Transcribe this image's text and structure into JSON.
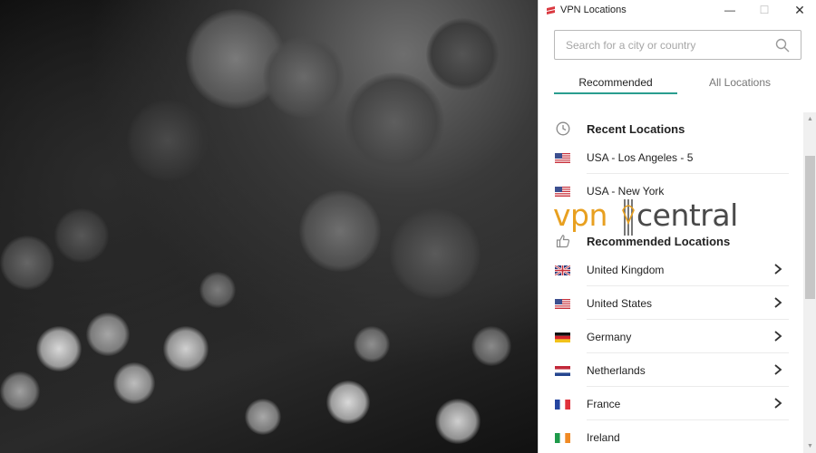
{
  "window": {
    "title": "VPN Locations",
    "minimize": "—",
    "maximize": "☐",
    "close": "✕"
  },
  "search": {
    "placeholder": "Search for a city or country",
    "value": ""
  },
  "tabs": [
    {
      "label": "Recommended",
      "active": true
    },
    {
      "label": "All Locations",
      "active": false
    }
  ],
  "recent": {
    "title": "Recent Locations",
    "items": [
      {
        "label": "USA - Los Angeles - 5",
        "flag": "us"
      },
      {
        "label": "USA - New York",
        "flag": "us"
      }
    ]
  },
  "recommended": {
    "title": "Recommended Locations",
    "items": [
      {
        "label": "United Kingdom",
        "flag": "gb"
      },
      {
        "label": "United States",
        "flag": "us"
      },
      {
        "label": "Germany",
        "flag": "de"
      },
      {
        "label": "Netherlands",
        "flag": "nl"
      },
      {
        "label": "France",
        "flag": "fr"
      },
      {
        "label": "Ireland",
        "flag": "ie"
      }
    ]
  },
  "watermark": {
    "vpn": "vpn",
    "central": "central"
  },
  "colors": {
    "accent": "#2a9d8f",
    "brand_red": "#da3940",
    "watermark_orange": "#e8a020"
  },
  "icons": {
    "app": "vpn-logo-icon",
    "search": "search-icon",
    "recent": "clock-icon",
    "recommended": "thumbs-up-icon",
    "row_action": "chevron-right-icon"
  }
}
